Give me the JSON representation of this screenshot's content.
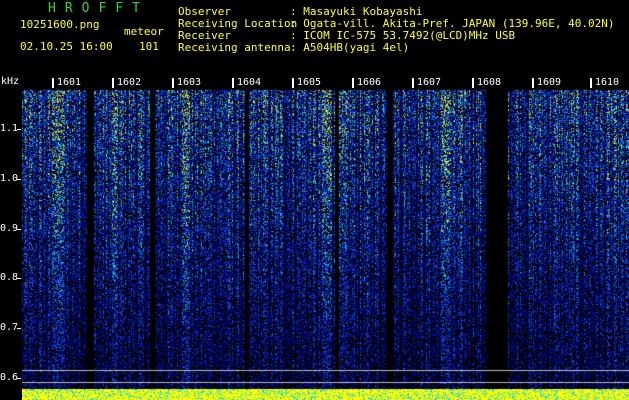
{
  "header": {
    "app_title": "HROFFT",
    "filename": "10251600.png",
    "mode": "meteor",
    "datetime": "02.10.25 16:00",
    "count": "101"
  },
  "station": {
    "observer_label": "Observer",
    "observer_value": ": Masayuki Kobayashi",
    "location_label": "Receiving Location",
    "location_value": ": Ogata-vill. Akita-Pref. JAPAN (139.96E, 40.02N)",
    "receiver_label": "Receiver",
    "receiver_value": ": ICOM IC-575 53.7492(@LCD)MHz USB",
    "antenna_label": "Receiving antenna",
    "antenna_value": ": A504HB(yagi 4el)"
  },
  "spectrogram": {
    "y_unit": "kHz",
    "y_ticks": [
      "1.1",
      "1.0",
      "0.9",
      "0.8",
      "0.7",
      "0.6"
    ],
    "minute_labels": [
      "1601",
      "1602",
      "1603",
      "1604",
      "1605",
      "1606",
      "1607",
      "1608",
      "1609",
      "1610"
    ],
    "colors": {
      "background": "#000000",
      "low": "#000c8c",
      "mid": "#1b53d6",
      "high": "#22d0d0",
      "peak": "#e4e42c",
      "bottom_band": "#ffff00"
    }
  }
}
